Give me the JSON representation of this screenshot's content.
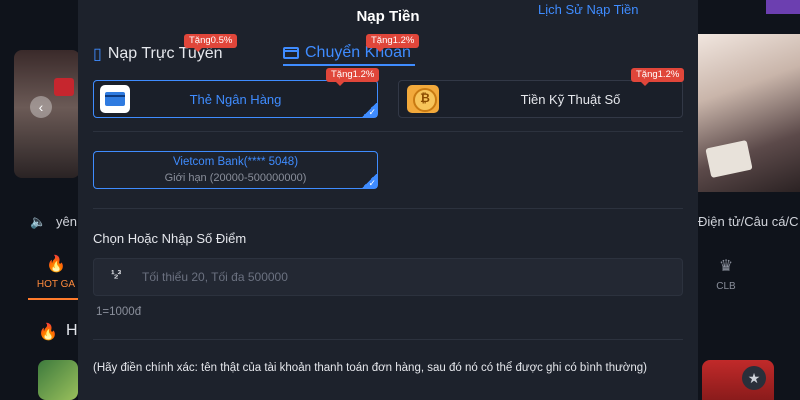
{
  "background": {
    "ticker_left": "yên",
    "ticker_right": "Điện tử/Câu cá/C",
    "nav_hot_label": "HOT GA",
    "nav_clb_label": "CLB",
    "section_title_partial": "H",
    "arrow_glyph": "‹"
  },
  "modal": {
    "title": "Nạp Tiền",
    "history_link": "Lịch Sử Nạp Tiền",
    "tabs": [
      {
        "label": "Nạp Trực Tuyến",
        "badge": "Tặng0.5%",
        "icon": "phone-icon"
      },
      {
        "label": "Chuyển Khoản",
        "badge": "Tặng1.2%",
        "icon": "wallet-icon",
        "active": true
      }
    ],
    "methods": [
      {
        "label": "Thẻ Ngân Hàng",
        "badge": "Tặng1.2%",
        "icon": "bank-card-icon",
        "selected": true
      },
      {
        "label": "Tiền Kỹ Thuật Số",
        "badge": "Tặng1.2%",
        "icon": "crypto-coin-icon",
        "selected": false
      }
    ],
    "bank": {
      "name": "Vietcom Bank(**** 5048)",
      "limit": "Giới hạn (20000-500000000)"
    },
    "points": {
      "label": "Chọn Hoặc Nhập Số Điểm",
      "icon_text": "¹₂³",
      "placeholder": "Tối thiểu 20, Tối đa 500000",
      "value": "",
      "rate": "1=1000đ"
    },
    "note": "(Hãy điền chính xác: tên thật của tài khoản thanh toán đơn hàng, sau đó nó có thể được ghi có bình thường)"
  },
  "colors": {
    "accent": "#3f8cff",
    "badge": "#e0463a",
    "modal_bg": "#1d222c",
    "page_bg": "#0d1017"
  }
}
